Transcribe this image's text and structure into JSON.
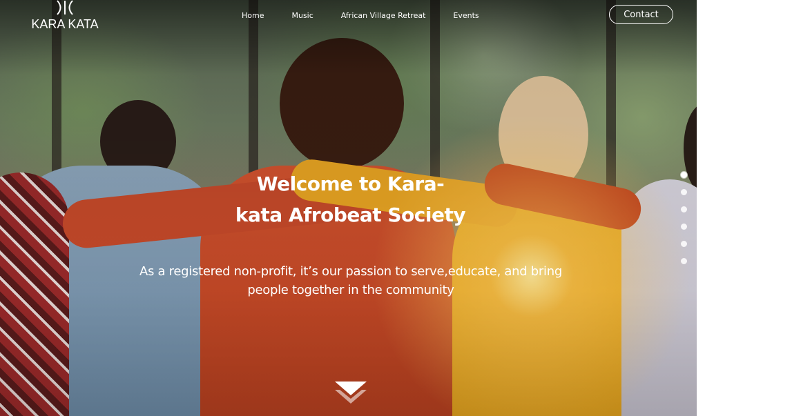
{
  "brand": {
    "logo_text": "KARA KATA",
    "logo_mark_icon": "kara-kata-asterisk-mark"
  },
  "nav": {
    "items": [
      {
        "label": "Home"
      },
      {
        "label": "Music"
      },
      {
        "label": "African Village Retreat"
      },
      {
        "label": "Events"
      }
    ],
    "contact_label": "Contact"
  },
  "hero": {
    "headline_line1": "Welcome to Kara-",
    "headline_line2": "kata Afrobeat Society",
    "subtext_line1": "As a registered non-profit, it’s our passion to serve,educate, and bring",
    "subtext_line2": "people together in the community",
    "slider_dot_count": 6,
    "active_slide": 1,
    "scroll_icon": "chevron-down-icon"
  },
  "colors": {
    "text": "#ffffff",
    "overlay": "#000000"
  }
}
